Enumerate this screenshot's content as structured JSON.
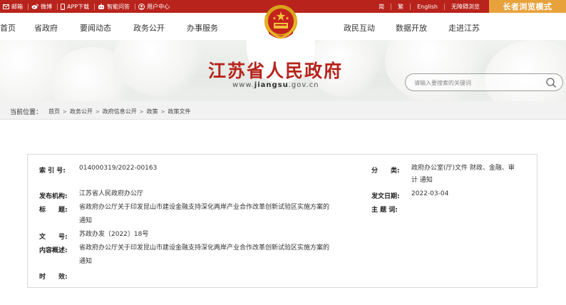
{
  "topbar": {
    "left_items": [
      {
        "icon": "mail-icon",
        "label": "邮箱"
      },
      {
        "icon": "weibo-icon",
        "label": "微博"
      },
      {
        "icon": "phone-icon",
        "label": "APP下载"
      },
      {
        "icon": "robot-icon",
        "label": "智能问答"
      },
      {
        "icon": "user-icon",
        "label": "用户中心"
      }
    ],
    "right_links": [
      "简",
      "繁",
      "English",
      "无障碍浏览"
    ],
    "elder_mode": "长者浏览模式"
  },
  "nav": {
    "items": [
      "首页",
      "省政府",
      "要闻动态",
      "政务公开",
      "办事服务",
      "政民互动",
      "数据开放",
      "走进江苏"
    ]
  },
  "banner": {
    "title": "江苏省人民政府",
    "url_prefix": "www.",
    "url_domain": "jiangsu",
    "url_suffix": ".gov.cn"
  },
  "search": {
    "placeholder": "请输入要搜索的关键词"
  },
  "breadcrumb": {
    "label": "当前位置：",
    "items": [
      "首页",
      "政务公开",
      "政府信息公开",
      "政策",
      "政策文件"
    ]
  },
  "meta": {
    "index_label": "索 引 号:",
    "index_value": "014000319/2022-00163",
    "class_label": "分　　类:",
    "class_value_1": "政府办公室(厅)文件 财政、金融、审",
    "class_value_2": "计 通知",
    "issuer_label": "发布机构:",
    "issuer_value": "江苏省人民政府办公厅",
    "date_label": "发文日期:",
    "date_value": "2022-03-04",
    "title_label": "标　　题:",
    "title_value_1": "省政府办公厅关于印发昆山市建设金融支持深化两岸产业合作改革创新试验区实施方案的",
    "title_value_2": "通知",
    "subject_label": "主 题 词:",
    "subject_value": "",
    "docno_label": "文　　号:",
    "docno_value": "苏政办发〔2022〕18号",
    "summary_label": "内容概述:",
    "summary_value_1": "省政府办公厅关于印发昆山市建设金融支持深化两岸产业合作改革创新试验区实施方案的",
    "summary_value_2": "通知",
    "validity_label": "时　　效:",
    "validity_value": ""
  },
  "colors": {
    "brand_red": "#b8231c",
    "elder_orange": "#e8a23c"
  }
}
